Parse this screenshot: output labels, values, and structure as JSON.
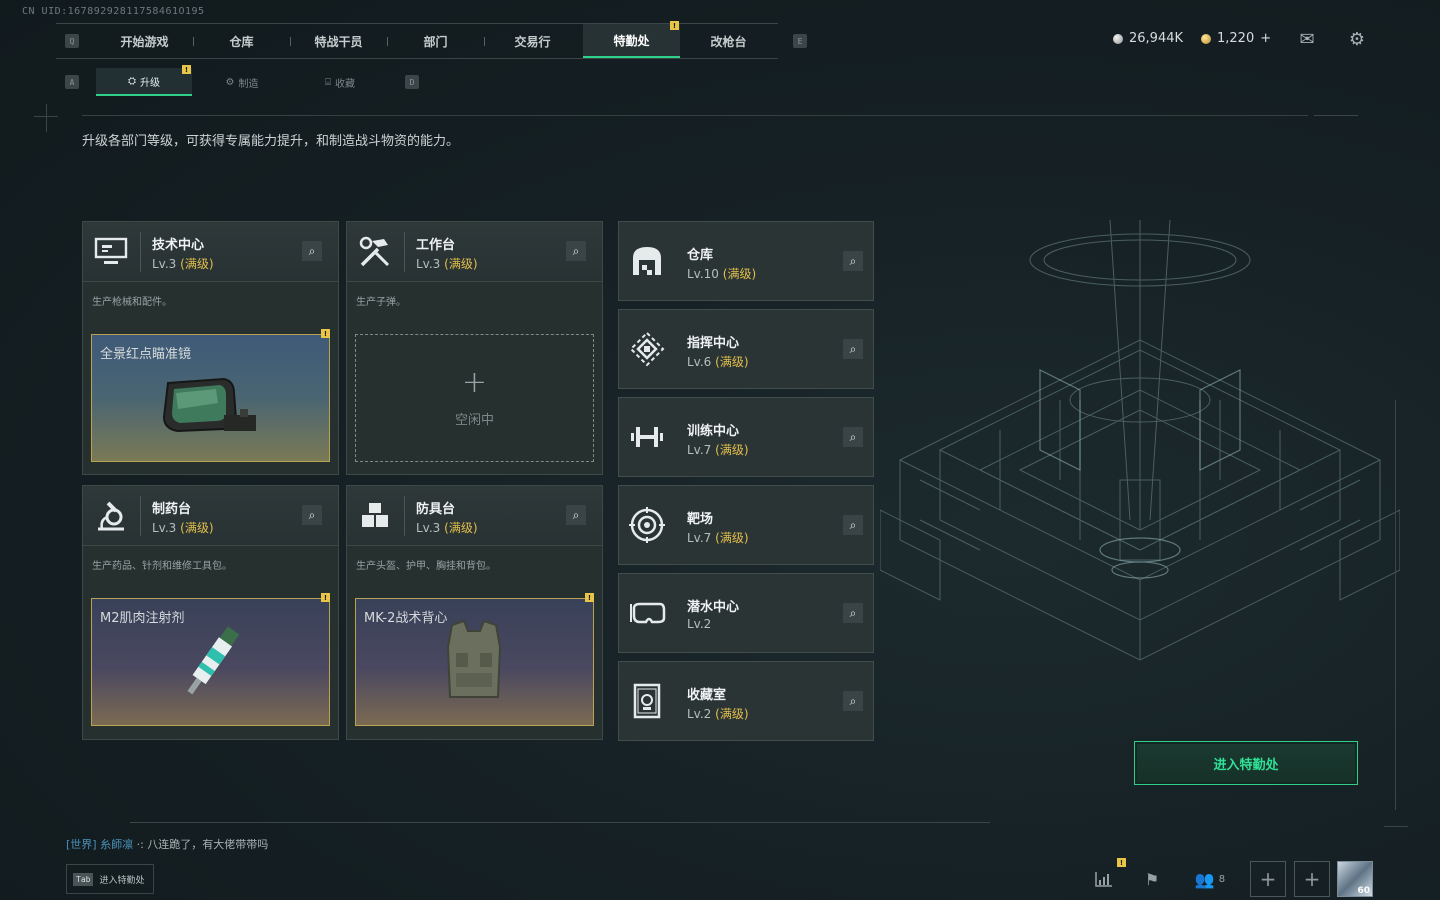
{
  "uid": "CN UID:16789292811758461O195",
  "nav": {
    "key_left": "Q",
    "key_right": "E",
    "tabs": [
      {
        "label": "开始游戏"
      },
      {
        "label": "仓库"
      },
      {
        "label": "特战干员"
      },
      {
        "label": "部门"
      },
      {
        "label": "交易行"
      },
      {
        "label": "特勤处",
        "active": true,
        "badge": "!"
      },
      {
        "label": "改枪台"
      }
    ]
  },
  "subnav": {
    "key_left": "A",
    "key_right": "D",
    "tabs": [
      {
        "label": "升级",
        "icon": "upgrade-icon",
        "active": true,
        "badge": "!"
      },
      {
        "label": "制造",
        "icon": "craft-icon"
      },
      {
        "label": "收藏",
        "icon": "collect-icon"
      }
    ]
  },
  "currency": {
    "silver": "26,944K",
    "gold": "1,220",
    "gold_add": "+"
  },
  "description": "升级各部门等级，可获得专属能力提升，和制造战斗物资的能力。",
  "stations": [
    {
      "name": "技术中心",
      "level": "Lv.3",
      "max": "(满级)",
      "info": "生产枪械和配件。",
      "slot": {
        "type": "blue",
        "label": "全景红点瞄准镜",
        "badge": "!"
      },
      "icon": "computer-icon"
    },
    {
      "name": "工作台",
      "level": "Lv.3",
      "max": "(满级)",
      "info": "生产子弹。",
      "slot": {
        "type": "empty",
        "plus": "+",
        "label": "空闲中"
      },
      "icon": "tools-icon"
    },
    {
      "name": "制药台",
      "level": "Lv.3",
      "max": "(满级)",
      "info": "生产药品、针剂和维修工具包。",
      "slot": {
        "type": "purple",
        "label": "M2肌肉注射剂",
        "badge": "!"
      },
      "icon": "microscope-icon"
    },
    {
      "name": "防具台",
      "level": "Lv.3",
      "max": "(满级)",
      "info": "生产头盔、护甲、胸挂和背包。",
      "slot": {
        "type": "purple",
        "label": "MK-2战术背心",
        "badge": "!"
      },
      "icon": "blocks-icon"
    }
  ],
  "departments": [
    {
      "name": "仓库",
      "level": "Lv.10",
      "max": "(满级)",
      "icon": "warehouse-icon"
    },
    {
      "name": "指挥中心",
      "level": "Lv.6",
      "max": "(满级)",
      "icon": "command-icon"
    },
    {
      "name": "训练中心",
      "level": "Lv.7",
      "max": "(满级)",
      "icon": "dumbbell-icon"
    },
    {
      "name": "靶场",
      "level": "Lv.7",
      "max": "(满级)",
      "icon": "target-icon"
    },
    {
      "name": "潜水中心",
      "level": "Lv.2",
      "max": "",
      "icon": "goggles-icon"
    },
    {
      "name": "收藏室",
      "level": "Lv.2",
      "max": "(满级)",
      "icon": "trophy-icon"
    }
  ],
  "enter_button": "进入特勤处",
  "chat": {
    "channel": "[世界]",
    "user": "糸師凛",
    "sep": "·:",
    "message": "八连跪了，有大佬带带吗"
  },
  "tab_hint": {
    "key": "Tab",
    "label": "进入特勤处"
  },
  "bottom": {
    "friends_count": "8",
    "stats_badge": "!",
    "avatar_level": "60"
  },
  "colors": {
    "accent": "#2fd18a",
    "max_level": "#e2bf4d",
    "warning": "#e8c547"
  }
}
